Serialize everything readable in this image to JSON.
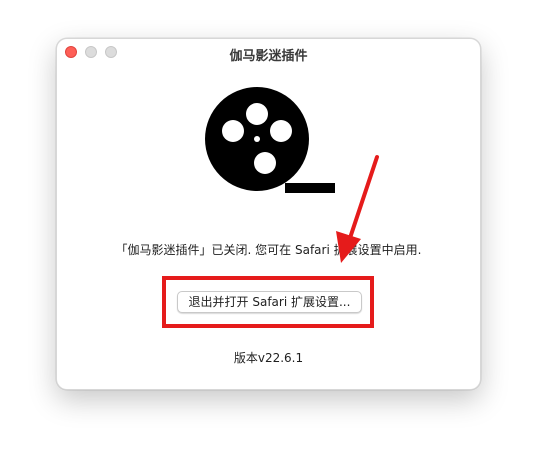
{
  "window": {
    "title": "伽马影迷插件"
  },
  "content": {
    "message": "「伽马影迷插件」已关闭. 您可在 Safari 扩展设置中启用.",
    "button_label": "退出并打开 Safari 扩展设置...",
    "version": "版本v22.6.1",
    "logo_icon": "film-reel-icon"
  },
  "annotation": {
    "highlight_color": "#e51b1b",
    "arrow_color": "#e51b1b"
  },
  "colors": {
    "close_button": "#fe5f57",
    "inactive_button": "#dcdcdc"
  }
}
